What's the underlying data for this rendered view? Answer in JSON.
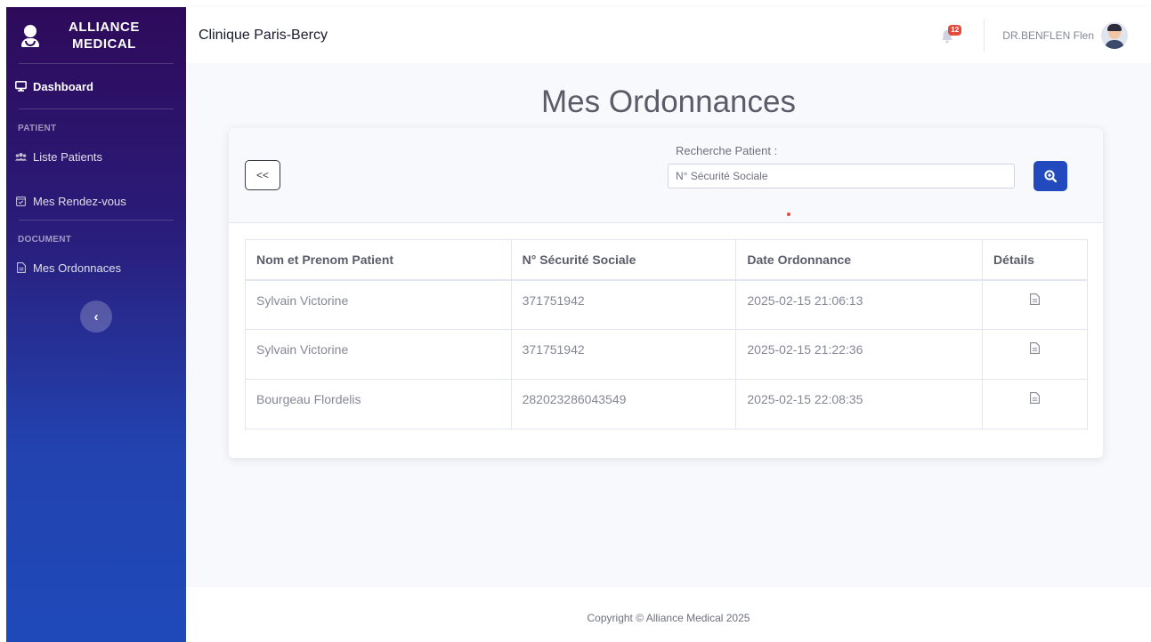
{
  "brand": {
    "line1": "ALLIANCE",
    "line2": "MEDICAL"
  },
  "sidebar": {
    "dashboard": "Dashboard",
    "section_patient": "PATIENT",
    "liste_patients": "Liste Patients",
    "rendez_vous": "Mes Rendez-vous",
    "section_document": "DOCUMENT",
    "ordonnances": "Mes Ordonnaces"
  },
  "topbar": {
    "clinic": "Clinique Paris-Bercy",
    "notification_count": "12",
    "user_name": "DR.BENFLEN Flen"
  },
  "page": {
    "title": "Mes Ordonnances"
  },
  "search": {
    "back_label": "<<",
    "label": "Recherche Patient :",
    "placeholder": "N° Sécurité Sociale"
  },
  "table": {
    "headers": [
      "Nom et Prenom Patient",
      "N° Sécurité Sociale",
      "Date Ordonnance",
      "Détails"
    ],
    "rows": [
      {
        "name": "Sylvain Victorine",
        "secu": "371751942",
        "date": "2025-02-15 21:06:13"
      },
      {
        "name": "Sylvain Victorine",
        "secu": "371751942",
        "date": "2025-02-15 21:22:36"
      },
      {
        "name": "Bourgeau Flordelis",
        "secu": "282023286043549",
        "date": "2025-02-15 22:08:35"
      }
    ]
  },
  "footer": {
    "text": "Copyright © Alliance Medical 2025"
  },
  "colors": {
    "accent": "#224abe",
    "sidebar_top": "#2e0a5a",
    "sidebar_bottom": "#1f49b9",
    "badge": "#e74a3b"
  }
}
